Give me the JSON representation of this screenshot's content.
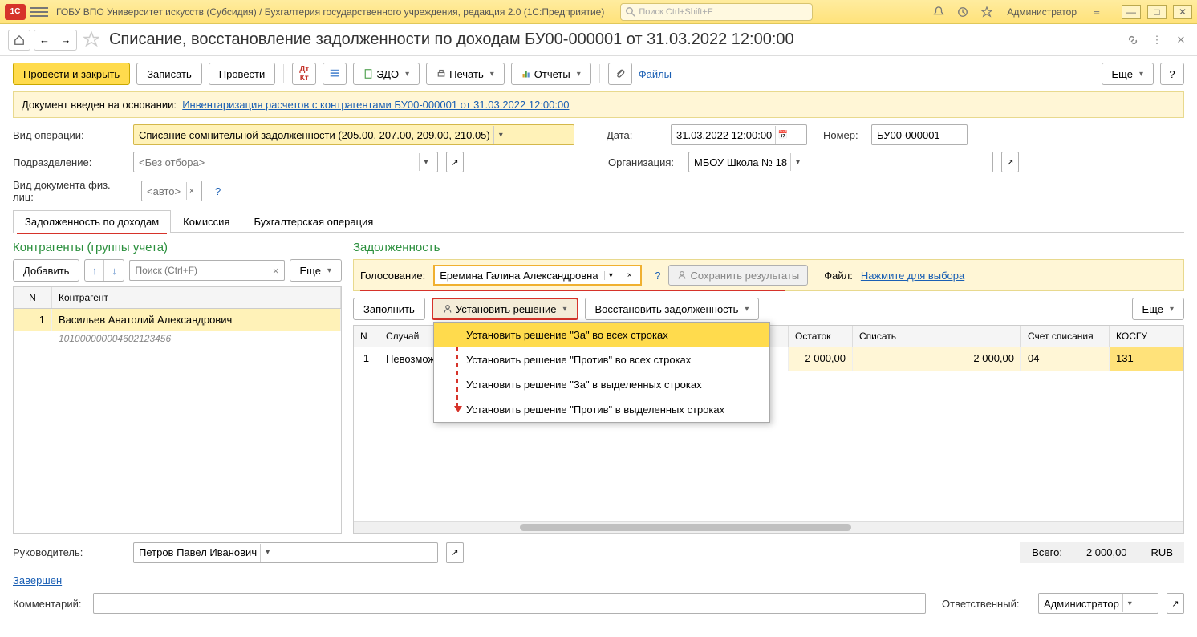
{
  "titlebar": {
    "org": "ГОБУ ВПО Университет искусств (Субсидия) / Бухгалтерия государственного учреждения, редакция 2.0  (1С:Предприятие)",
    "search_placeholder": "Поиск Ctrl+Shift+F",
    "admin": "Администратор"
  },
  "doc": {
    "title": "Списание, восстановление задолженности по доходам БУ00-000001 от 31.03.2022 12:00:00"
  },
  "toolbar": {
    "post_close": "Провести и закрыть",
    "save": "Записать",
    "post": "Провести",
    "edo": "ЭДО",
    "print": "Печать",
    "reports": "Отчеты",
    "files": "Файлы",
    "more": "Еще"
  },
  "banner": {
    "label": "Документ введен на основании:",
    "link": "Инвентаризация расчетов с контрагентами БУ00-000001 от 31.03.2022 12:00:00"
  },
  "form": {
    "op_type_label": "Вид операции:",
    "op_type": "Списание сомнительной задолженности (205.00, 207.00, 209.00, 210.05)",
    "date_label": "Дата:",
    "date": "31.03.2022 12:00:00",
    "number_label": "Номер:",
    "number": "БУ00-000001",
    "dept_label": "Подразделение:",
    "dept_placeholder": "<Без отбора>",
    "org_label": "Организация:",
    "org": "МБОУ Школа № 18",
    "doc_type_label": "Вид документа физ. лиц:",
    "doc_type_placeholder": "<авто>"
  },
  "tabs": {
    "t1": "Задолженность по доходам",
    "t2": "Комиссия",
    "t3": "Бухгалтерская операция"
  },
  "left": {
    "title": "Контрагенты (группы учета)",
    "add": "Добавить",
    "more": "Еще",
    "search_placeholder": "Поиск (Ctrl+F)",
    "col_n": "N",
    "col_name": "Контрагент",
    "rows": [
      {
        "n": "1",
        "name": "Васильев Анатолий Александрович",
        "sub": "101000000004602123456"
      }
    ]
  },
  "right": {
    "title": "Задолженность",
    "vote_label": "Голосование:",
    "voter": "Еремина Галина Александровна",
    "save_results": "Сохранить результаты",
    "file_label": "Файл:",
    "file_link": "Нажмите для выбора",
    "fill": "Заполнить",
    "set_decision": "Установить решение",
    "restore": "Восстановить задолженность",
    "more": "Еще",
    "menu": {
      "m1": "Установить решение \"За\" во всех строках",
      "m2": "Установить решение \"Против\" во всех строках",
      "m3": "Установить решение \"За\" в выделенных строках",
      "m4": "Установить решение \"Против\" в выделенных строках"
    },
    "cols": {
      "n": "N",
      "case": "Случай",
      "balance": "Остаток",
      "writeoff": "Списать",
      "account": "Счет списания",
      "kosgu": "КОСГУ"
    },
    "rows": [
      {
        "n": "1",
        "case": "Невозможность установить",
        "balance": "2 000,00",
        "writeoff": "2 000,00",
        "account": "04",
        "kosgu": "131"
      }
    ]
  },
  "footer": {
    "head_label": "Руководитель:",
    "head": "Петров Павел Иванович",
    "completed": "Завершен",
    "comment_label": "Комментарий:",
    "responsible_label": "Ответственный:",
    "responsible": "Администратор",
    "total_label": "Всего:",
    "total": "2 000,00",
    "currency": "RUB"
  }
}
